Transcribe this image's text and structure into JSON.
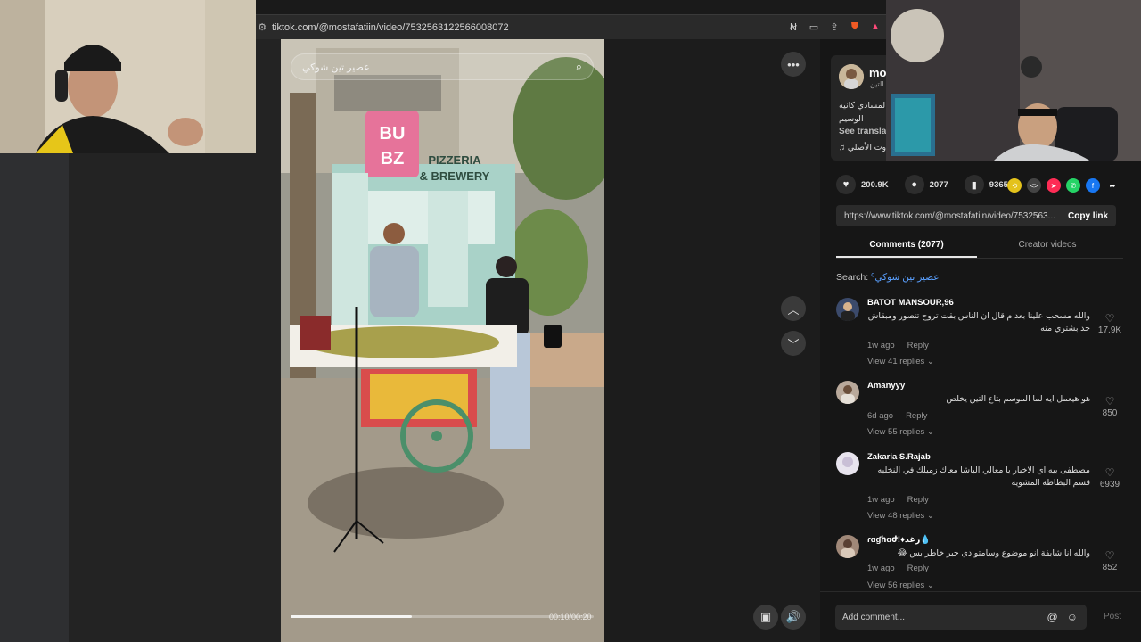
{
  "browser": {
    "url": "tiktok.com/@mostafatiin/video/7532563122566008072",
    "toolbar_icons": [
      "translate-icon",
      "cast-icon",
      "share-icon",
      "brave-shield-icon",
      "rewards-icon"
    ]
  },
  "video": {
    "search_text": "عصير تين شوكي",
    "time": "00:10/00:20",
    "progress": 0.4,
    "sign_line1": "BU BZ",
    "sign_line2": "PIZZERIA",
    "sign_line3": "& BREWERY"
  },
  "creator": {
    "name": "mo",
    "subtitle": "التين",
    "desc_line1": "المسادي كانيه",
    "desc_line2": "الوسيم",
    "see_translate": "See translat",
    "music": "♫ وت الأصلي"
  },
  "stats": {
    "likes": "200.9K",
    "comments": "2077",
    "saves": "9365"
  },
  "share_link": {
    "url": "https://www.tiktok.com/@mostafatiin/video/7532563...",
    "copy_label": "Copy link"
  },
  "tabs": {
    "comments": "Comments (2077)",
    "creator_videos": "Creator videos"
  },
  "search": {
    "label": "Search:",
    "query": "عصير تين شوكي"
  },
  "comments": [
    {
      "user": "BATOT MANSOUR,96",
      "text": "والله مسحب علينا بعد م قال ان الناس بقت تروح تتصور ومبقاش حد بشتري منه",
      "age": "1w ago",
      "reply": "Reply",
      "replies": "View 41 replies",
      "likes": "17.9K"
    },
    {
      "user": "Amanyyy",
      "text": "هو هيعمل ايه لما الموسم بتاع التين يخلص",
      "age": "6d ago",
      "reply": "Reply",
      "replies": "View 55 replies",
      "likes": "850"
    },
    {
      "user": "Zakaria S.Rajab",
      "text": "مصطفى بيه اي الاخبار يا معالي الباشا معاك زميلك في النخليه قسم البطاطه المشويه",
      "age": "1w ago",
      "reply": "Reply",
      "replies": "View 48 replies",
      "likes": "6939"
    },
    {
      "user": "ɾɑɠհɑժ!♦رغد💧",
      "text": "والله انا شايفة انو موضوع وسامتو دي جبر خاطر بس 😂",
      "age": "1w ago",
      "reply": "Reply",
      "replies": "View 56 replies",
      "likes": "852"
    }
  ],
  "composer": {
    "placeholder": "Add comment...",
    "post_label": "Post"
  }
}
